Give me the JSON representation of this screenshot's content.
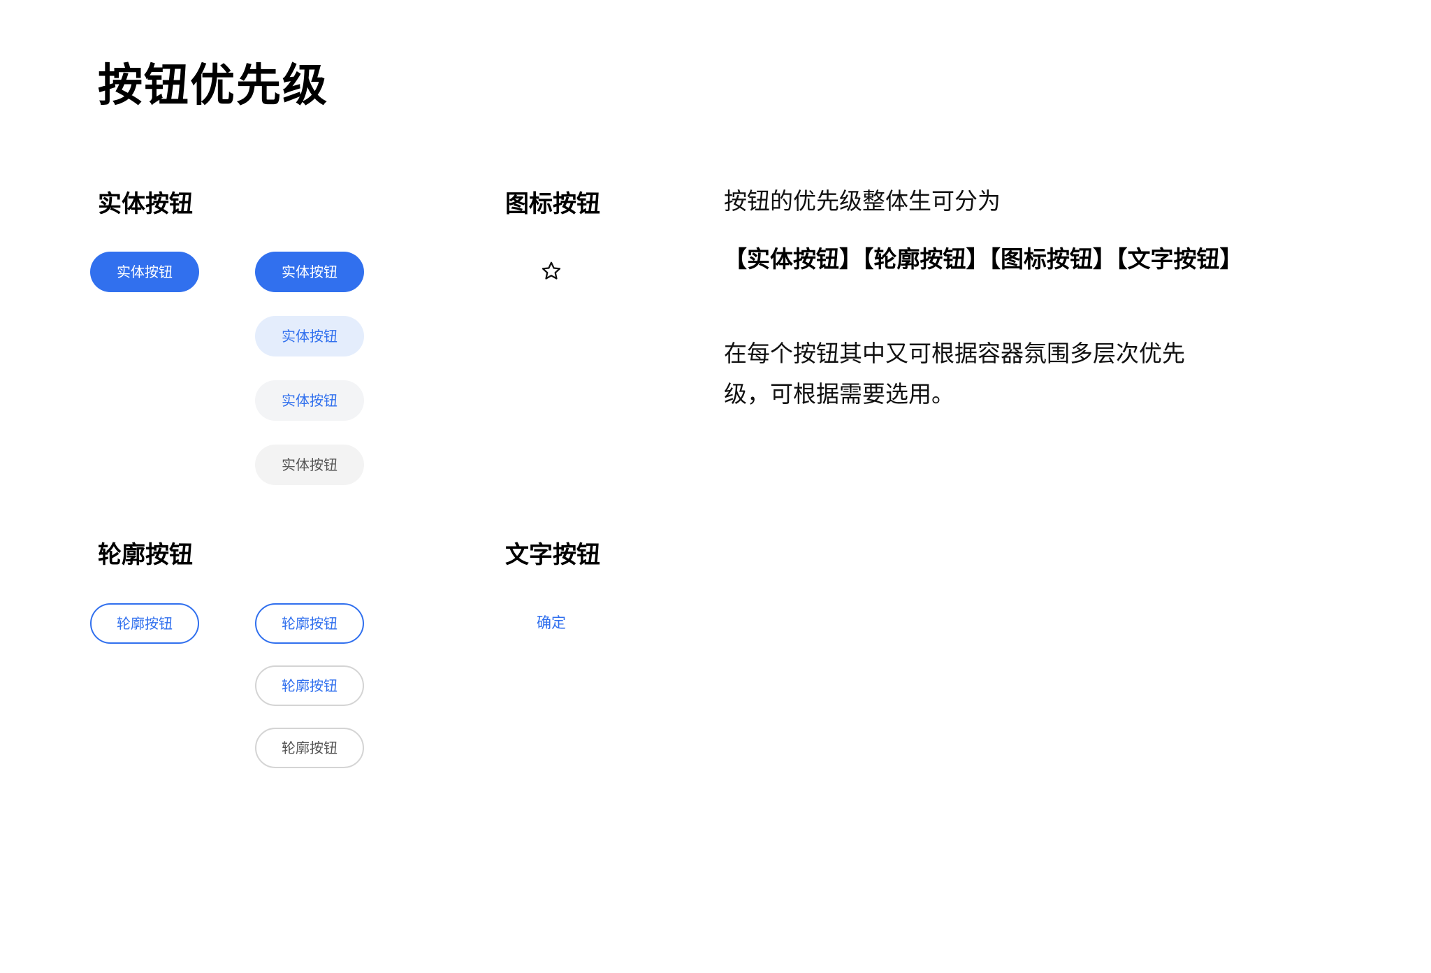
{
  "page": {
    "title": "按钮优先级"
  },
  "sections": {
    "solid": {
      "title": "实体按钮",
      "buttons": [
        "实体按钮",
        "实体按钮",
        "实体按钮",
        "实体按钮",
        "实体按钮"
      ]
    },
    "icon": {
      "title": "图标按钮",
      "icon": "star-outline-icon"
    },
    "outline": {
      "title": "轮廓按钮",
      "buttons": [
        "轮廓按钮",
        "轮廓按钮",
        "轮廓按钮",
        "轮廓按钮"
      ]
    },
    "text": {
      "title": "文字按钮",
      "button": "确定"
    }
  },
  "description": {
    "intro": "按钮的优先级整体生可分为",
    "types": "【实体按钮】【轮廓按钮】【图标按钮】【文字按钮】",
    "detail_line1": "在每个按钮其中又可根据容器氛围多层次优先",
    "detail_line2": "级，可根据需要选用。"
  },
  "colors": {
    "primary": "#3170ee",
    "primary_light": "#e4edfc",
    "light_gray_bg": "#f3f4f6",
    "neutral_text": "#555555",
    "outline_gray": "#d4d4d4"
  }
}
